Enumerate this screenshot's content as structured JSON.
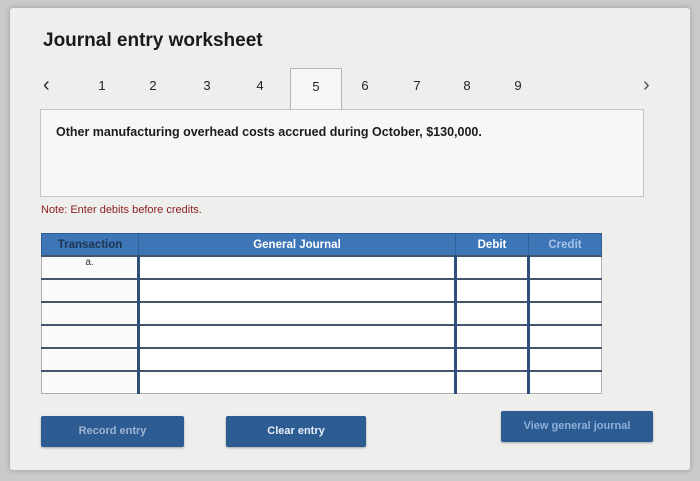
{
  "page": {
    "title": "Journal entry worksheet",
    "nav": {
      "prev_icon": "‹",
      "next_icon": "›",
      "tabs": [
        "1",
        "2",
        "3",
        "4",
        "5",
        "6",
        "7",
        "8",
        "9"
      ],
      "active_tab": "5"
    },
    "description": "Other manufacturing overhead costs accrued during October, $130,000.",
    "note": "Note: Enter debits before credits."
  },
  "table": {
    "headers": {
      "transaction": "Transaction",
      "general_journal": "General Journal",
      "debit": "Debit",
      "credit": "Credit"
    },
    "rows": [
      {
        "transaction": "a."
      },
      {
        "transaction": ""
      },
      {
        "transaction": ""
      },
      {
        "transaction": ""
      },
      {
        "transaction": ""
      },
      {
        "transaction": ""
      }
    ]
  },
  "buttons": {
    "record": "Record entry",
    "clear": "Clear entry",
    "view": "View general journal"
  },
  "colors": {
    "header_blue": "#3e75b6",
    "button_blue": "#2d5c93",
    "note_red": "#8a1f1f"
  }
}
